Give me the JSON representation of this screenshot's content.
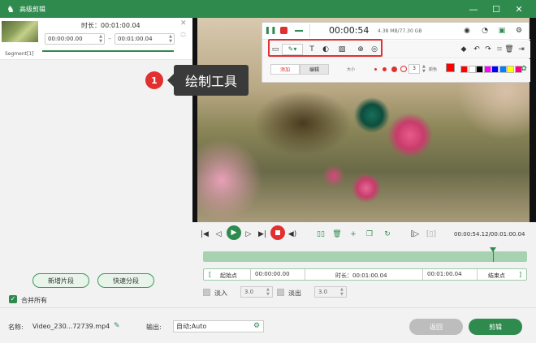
{
  "window": {
    "title": "高级剪辑",
    "minimize": "—",
    "maximize": "☐",
    "close": "✕"
  },
  "segment": {
    "duration_label": "时长：00:01:00.04",
    "start": "00:00:00.00",
    "end": "00:01:00.04",
    "dash": "–",
    "name": "Segment[1]"
  },
  "left": {
    "new_segment": "新增片段",
    "quick_split": "快速分段",
    "merge_all": "合并所有"
  },
  "callout": {
    "number": "1",
    "text": "绘制工具"
  },
  "toolbar": {
    "time": "00:00:54",
    "size": "4.38 MB/77.30 GB",
    "tab_add": "添加",
    "tab_edit": "编辑",
    "size_label": "大小",
    "size_value": "3",
    "color_label": "颜色"
  },
  "colors": {
    "accent": "#2f8a4e",
    "swatches": [
      "#ff0000",
      "#ffffff",
      "#000000",
      "#ff00ff",
      "#0000ff",
      "#0080ff",
      "#ffff00",
      "#ff0080"
    ]
  },
  "player": {
    "time": "00:00:54.12/00:01:00.04"
  },
  "range": {
    "start_btn": "起始点",
    "start_time": "00:00:00.00",
    "duration": "时长：00:01:00.04",
    "end_time": "00:01:00.04",
    "end_btn": "结束点"
  },
  "fade": {
    "in_label": "淡入",
    "in_value": "3.0",
    "out_label": "淡出",
    "out_value": "3.0"
  },
  "bottom": {
    "name_label": "名称:",
    "file_name": "Video_230...72739.mp4",
    "output_label": "输出:",
    "output_value": "自动;Auto",
    "back": "返回",
    "cut": "剪辑"
  }
}
